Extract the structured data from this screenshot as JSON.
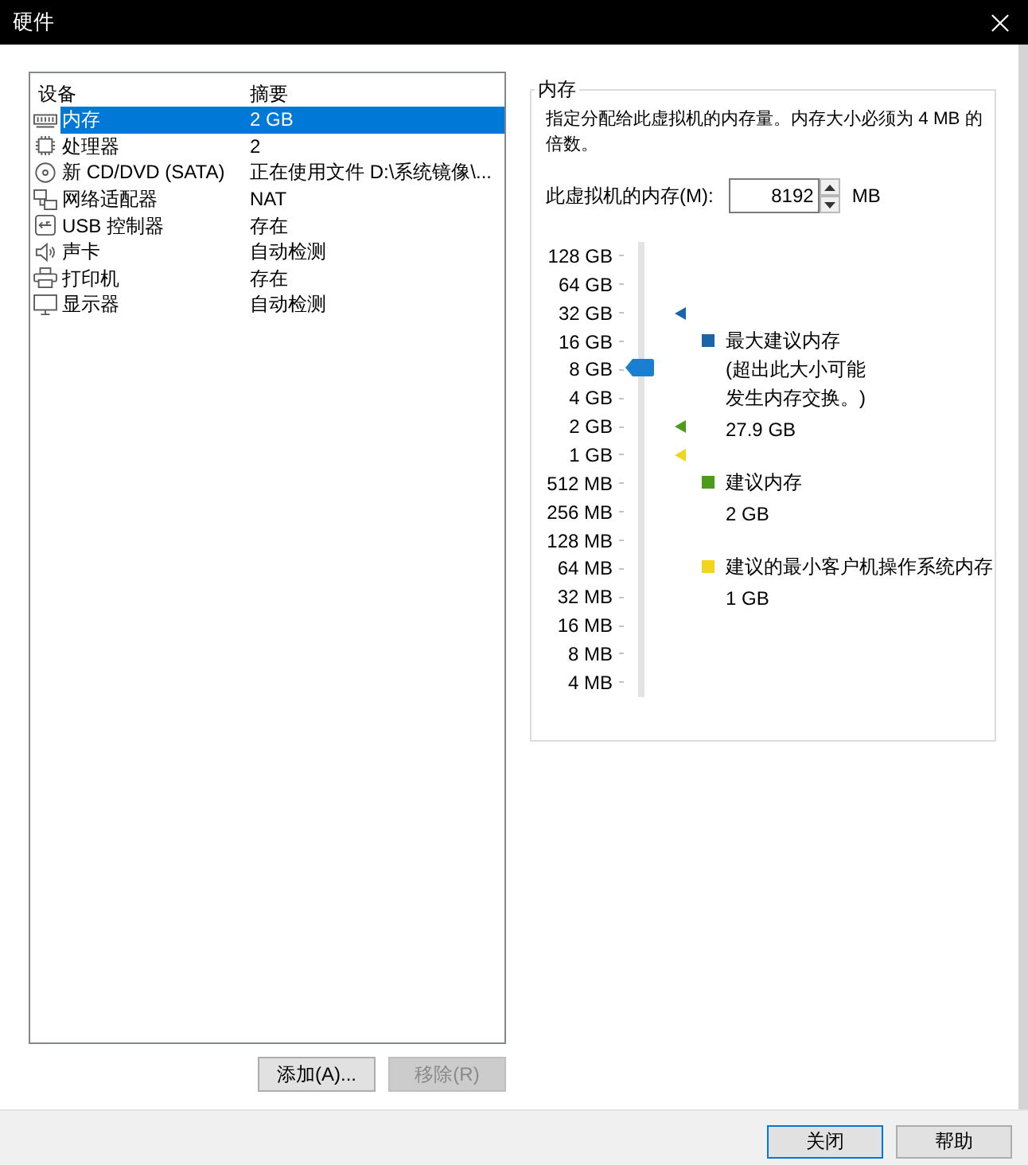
{
  "window": {
    "title": "硬件"
  },
  "devices": {
    "columns": [
      "设备",
      "摘要"
    ],
    "rows": [
      {
        "kind": "memory",
        "name": "内存",
        "summary": "2 GB",
        "selected": true
      },
      {
        "kind": "processor",
        "name": "处理器",
        "summary": "2",
        "selected": false
      },
      {
        "kind": "disc",
        "name": "新 CD/DVD (SATA)",
        "summary": "正在使用文件 D:\\系统镜像\\...",
        "selected": false
      },
      {
        "kind": "network",
        "name": "网络适配器",
        "summary": "NAT",
        "selected": false
      },
      {
        "kind": "usb",
        "name": "USB 控制器",
        "summary": "存在",
        "selected": false
      },
      {
        "kind": "sound",
        "name": "声卡",
        "summary": "自动检测",
        "selected": false
      },
      {
        "kind": "printer",
        "name": "打印机",
        "summary": "存在",
        "selected": false
      },
      {
        "kind": "display",
        "name": "显示器",
        "summary": "自动检测",
        "selected": false
      }
    ]
  },
  "device_buttons": [
    {
      "label": "添加(A)...",
      "disabled": false
    },
    {
      "label": "移除(R)",
      "disabled": true
    }
  ],
  "memory": {
    "group_title": "内存",
    "description": "指定分配给此虚拟机的内存量。内存大小必须为 4 MB 的倍数。",
    "field_label": "此虚拟机的内存(M):",
    "value": "8192",
    "unit": "MB",
    "slider": {
      "ticks": [
        "128 GB",
        "64 GB",
        "32 GB",
        "16 GB",
        "8 GB",
        "4 GB",
        "2 GB",
        "1 GB",
        "512 MB",
        "256 MB",
        "128 MB",
        "64 MB",
        "32 MB",
        "16 MB",
        "8 MB",
        "4 MB"
      ],
      "level": 0.722,
      "markers": [
        {
          "color": "#1c64a8",
          "level": 0.842
        },
        {
          "color": "#4d9a1c",
          "level": 0.595
        },
        {
          "color": "#f0d41e",
          "level": 0.532
        }
      ]
    },
    "legend": [
      {
        "title": "最大建议内存",
        "note": "(超出此大小可能发生内存交换。)",
        "value": "27.9 GB",
        "color": "#1c64a8"
      },
      {
        "title": "建议内存",
        "value": "2 GB",
        "color": "#4d9a1c"
      },
      {
        "title": "建议的最小客户机操作系统内存",
        "value": "1 GB",
        "color": "#f0d41e"
      }
    ]
  },
  "footer_buttons": [
    {
      "label": "关闭",
      "default": true
    },
    {
      "label": "帮助",
      "default": false
    }
  ]
}
